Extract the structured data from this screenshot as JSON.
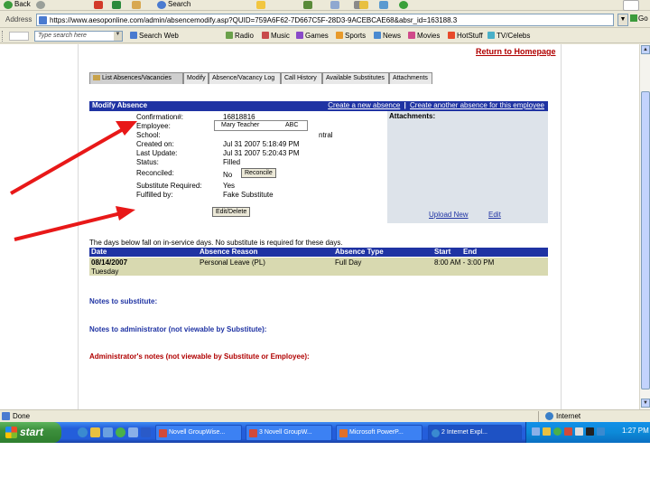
{
  "browser": {
    "toolbar": {
      "back_label": "Back",
      "search_label": "Search",
      "go_label": "Go"
    },
    "address_label": "Address",
    "url": "https://www.aesoponline.com/admin/absencemodify.asp?QUID=759A6F62-7D667C5F-28D3-9ACEBCAE68&absr_id=163188.3",
    "links": {
      "search_value": "Type search here",
      "items": [
        "Search Web",
        "Radio",
        "Music",
        "Games",
        "Sports",
        "News",
        "Movies",
        "HotStuff",
        "TV/Celebs"
      ]
    },
    "status": "Done",
    "zone": "Internet"
  },
  "page": {
    "return_link": "Return to Homepage",
    "tabs": [
      "List Absences/Vacancies",
      "Modify",
      "Absence/Vacancy Log",
      "Call History",
      "Available Substitutes",
      "Attachments"
    ],
    "form": {
      "title": "Modify Absence",
      "action_create": "Create a new absence",
      "action_sep": "|",
      "action_another": "Create another absence for this employee",
      "attachments_label": "Attachments:",
      "upload_link": "Upload New",
      "edit_link": "Edit",
      "fields": [
        {
          "label": "Confirmation#:",
          "value": "16818816"
        },
        {
          "label": "Employee:",
          "value": ""
        },
        {
          "label": "School:",
          "value": "ntral"
        },
        {
          "label": "Created on:",
          "value": "Jul 31 2007 5:18:49 PM"
        },
        {
          "label": "Last Update:",
          "value": "Jul 31 2007 5:20:43 PM"
        },
        {
          "label": "Status:",
          "value": "Filled"
        },
        {
          "label": "Reconciled:",
          "value": "No"
        },
        {
          "label": "Substitute Required:",
          "value": "Yes"
        },
        {
          "label": "Fulfilled by:",
          "value": "Fake Substitute"
        }
      ],
      "overlay_employee": "Mary Teacher",
      "overlay_school": "ABC",
      "reconcile_btn": "Reconcile",
      "edit_delete_btn": "Edit/Delete"
    },
    "inservice_note": "The days below fall on in-service days. No substitute is required for these days.",
    "grid": {
      "headers": [
        "Date",
        "Absence Reason",
        "Absence Type",
        "Start",
        "End"
      ],
      "row": {
        "date": "08/14/2007",
        "day": "Tuesday",
        "reason": "Personal Leave (PL)",
        "type": "Full Day",
        "time": "8:00 AM - 3:00 PM"
      }
    },
    "notes": {
      "substitute": "Notes to substitute:",
      "administrator": "Notes to administrator (not viewable by Substitute):",
      "admin_notes": "Administrator's notes (not viewable by Substitute or Employee):"
    }
  },
  "taskbar": {
    "start": "start",
    "tasks": [
      "Novell GroupWise...",
      "3 Novell GroupW...",
      "Microsoft PowerP...",
      "2 Internet Expl..."
    ],
    "clock": "1:27 PM"
  },
  "colors": {
    "header_blue": "#1f33a3",
    "row_olive": "#d8d9b0",
    "red_text": "#b00000",
    "arrow_red": "#e81818"
  }
}
